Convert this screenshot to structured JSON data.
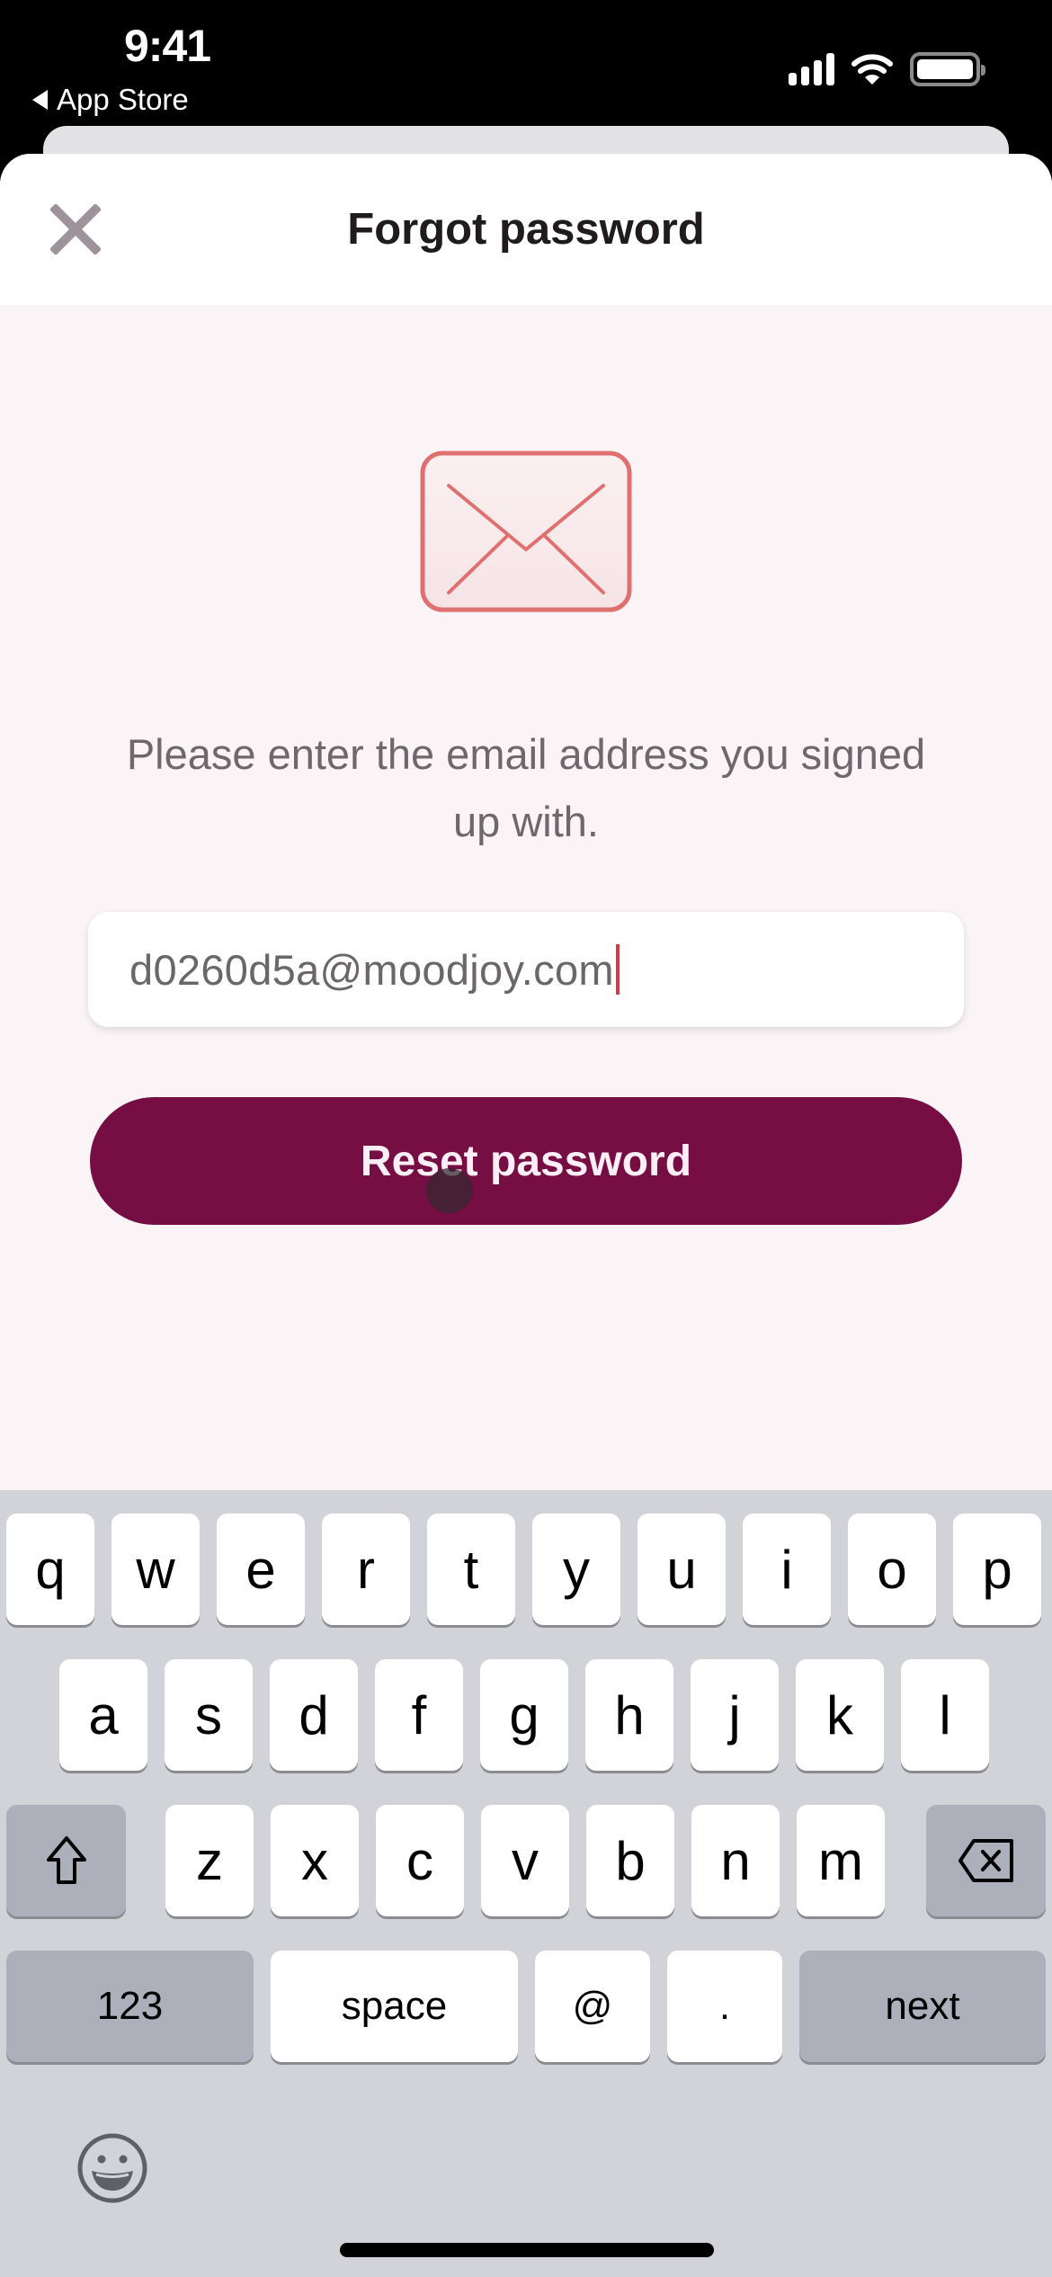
{
  "status_bar": {
    "time": "9:41",
    "back_app": "App Store",
    "icons": [
      "signal-icon",
      "wifi-icon",
      "battery-icon"
    ]
  },
  "sheet": {
    "title": "Forgot password",
    "close_icon": "close-icon",
    "illustration": "envelope-icon",
    "instructions": "Please enter the email address you signed up with.",
    "email_field": {
      "value": "d0260d5a@moodjoy.com",
      "placeholder": ""
    },
    "reset_button": "Reset password"
  },
  "colors": {
    "primary": "#760e44",
    "envelope": "#e07070",
    "caret": "#d43a4a",
    "sheet_bg": "#faf4f7"
  },
  "keyboard": {
    "row1": [
      "q",
      "w",
      "e",
      "r",
      "t",
      "y",
      "u",
      "i",
      "o",
      "p"
    ],
    "row2": [
      "a",
      "s",
      "d",
      "f",
      "g",
      "h",
      "j",
      "k",
      "l"
    ],
    "row3": [
      "z",
      "x",
      "c",
      "v",
      "b",
      "n",
      "m"
    ],
    "shift_icon": "shift-icon",
    "delete_icon": "delete-icon",
    "numbers_label": "123",
    "space_label": "space",
    "at_label": "@",
    "dot_label": ".",
    "next_label": "next",
    "emoji_icon": "emoji-icon"
  }
}
